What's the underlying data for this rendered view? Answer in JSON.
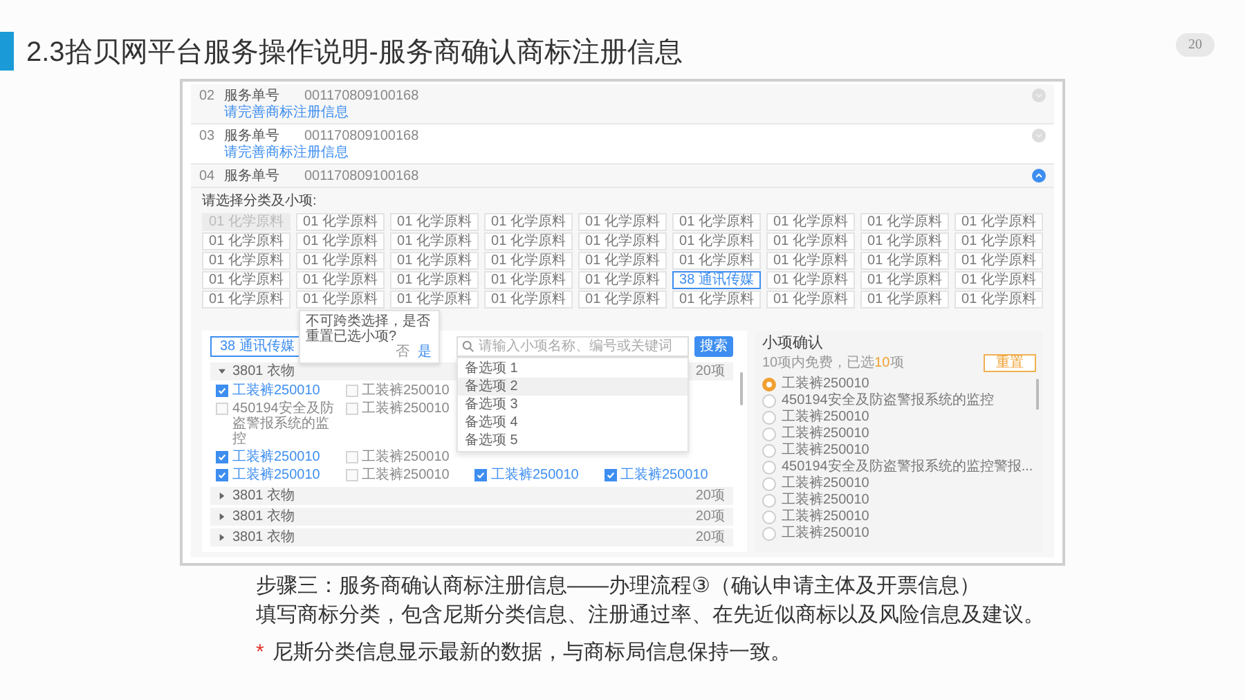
{
  "header": {
    "title": "2.3拾贝网平台服务操作说明-服务商确认商标注册信息",
    "page_number": "20"
  },
  "app": {
    "services": [
      {
        "index": "02",
        "label": "服务单号",
        "number": "001170809100168",
        "link": "请完善商标注册信息",
        "expanded": false
      },
      {
        "index": "03",
        "label": "服务单号",
        "number": "001170809100168",
        "link": "请完善商标注册信息",
        "expanded": false
      },
      {
        "index": "04",
        "label": "服务单号",
        "number": "001170809100168",
        "expanded": true
      }
    ],
    "class_prompt": "请选择分类及小项:",
    "class_rows": [
      [
        {
          "label": "01 化学原料",
          "disabled": true,
          "selected": false
        },
        {
          "label": "01 化学原料",
          "disabled": false,
          "selected": false
        },
        {
          "label": "01 化学原料",
          "disabled": false,
          "selected": false
        },
        {
          "label": "01 化学原料",
          "disabled": false,
          "selected": false
        },
        {
          "label": "01 化学原料",
          "disabled": false,
          "selected": false
        },
        {
          "label": "01 化学原料",
          "disabled": false,
          "selected": false
        },
        {
          "label": "01 化学原料",
          "disabled": false,
          "selected": false
        },
        {
          "label": "01 化学原料",
          "disabled": false,
          "selected": false
        },
        {
          "label": "01 化学原料",
          "disabled": false,
          "selected": false
        }
      ],
      [
        {
          "label": "01 化学原料",
          "disabled": false,
          "selected": false
        },
        {
          "label": "01 化学原料",
          "disabled": false,
          "selected": false
        },
        {
          "label": "01 化学原料",
          "disabled": false,
          "selected": false
        },
        {
          "label": "01 化学原料",
          "disabled": false,
          "selected": false
        },
        {
          "label": "01 化学原料",
          "disabled": false,
          "selected": false
        },
        {
          "label": "01 化学原料",
          "disabled": false,
          "selected": false
        },
        {
          "label": "01 化学原料",
          "disabled": false,
          "selected": false
        },
        {
          "label": "01 化学原料",
          "disabled": false,
          "selected": false
        },
        {
          "label": "01 化学原料",
          "disabled": false,
          "selected": false
        }
      ],
      [
        {
          "label": "01 化学原料",
          "disabled": false,
          "selected": false
        },
        {
          "label": "01 化学原料",
          "disabled": false,
          "selected": false
        },
        {
          "label": "01 化学原料",
          "disabled": false,
          "selected": false
        },
        {
          "label": "01 化学原料",
          "disabled": false,
          "selected": false
        },
        {
          "label": "01 化学原料",
          "disabled": false,
          "selected": false
        },
        {
          "label": "01 化学原料",
          "disabled": false,
          "selected": false
        },
        {
          "label": "01 化学原料",
          "disabled": false,
          "selected": false
        },
        {
          "label": "01 化学原料",
          "disabled": false,
          "selected": false
        },
        {
          "label": "01 化学原料",
          "disabled": false,
          "selected": false
        }
      ],
      [
        {
          "label": "01 化学原料",
          "disabled": false,
          "selected": false
        },
        {
          "label": "01 化学原料",
          "disabled": false,
          "selected": false
        },
        {
          "label": "01 化学原料",
          "disabled": false,
          "selected": false
        },
        {
          "label": "01 化学原料",
          "disabled": false,
          "selected": false
        },
        {
          "label": "01 化学原料",
          "disabled": false,
          "selected": false
        },
        {
          "label": "38 通讯传媒",
          "disabled": false,
          "selected": true
        },
        {
          "label": "01 化学原料",
          "disabled": false,
          "selected": false
        },
        {
          "label": "01 化学原料",
          "disabled": false,
          "selected": false
        },
        {
          "label": "01 化学原料",
          "disabled": false,
          "selected": false
        }
      ],
      [
        {
          "label": "01 化学原料",
          "disabled": false,
          "selected": false
        },
        {
          "label": "01 化学原料",
          "disabled": false,
          "selected": false
        },
        {
          "label": "01 化学原料",
          "disabled": false,
          "selected": false
        },
        {
          "label": "01 化学原料",
          "disabled": false,
          "selected": false
        },
        {
          "label": "01 化学原料",
          "disabled": false,
          "selected": false
        },
        {
          "label": "01 化学原料",
          "disabled": false,
          "selected": false
        },
        {
          "label": "01 化学原料",
          "disabled": false,
          "selected": false
        },
        {
          "label": "01 化学原料",
          "disabled": false,
          "selected": false
        },
        {
          "label": "01 化学原料",
          "disabled": false,
          "selected": false
        }
      ]
    ],
    "popover": {
      "message": "不可跨类选择，是否重置已选小项?",
      "buttons": [
        "否",
        "是"
      ]
    },
    "selected_class_button": "38 通讯传媒",
    "search": {
      "placeholder": "请输入小项名称、编号或关键词",
      "button": "搜索",
      "options": [
        {
          "label": "备选项 1",
          "selected": false
        },
        {
          "label": "备选项 2",
          "selected": true
        },
        {
          "label": "备选项 3",
          "selected": false
        },
        {
          "label": "备选项 4",
          "selected": false
        },
        {
          "label": "备选项 5",
          "selected": false
        }
      ]
    },
    "groups": [
      {
        "name": "3801 衣物",
        "count": "20项",
        "expanded": true,
        "rows": [
          [
            {
              "label": "工装裤250010",
              "checked": true
            },
            {
              "label": "工装裤250010",
              "checked": false
            }
          ],
          [
            {
              "label": "450194安全及防盗警报系统的监控",
              "checked": false
            },
            {
              "label": "工装裤250010",
              "checked": false
            }
          ],
          [
            {
              "label": "工装裤250010",
              "checked": true
            },
            {
              "label": "工装裤250010",
              "checked": false
            }
          ],
          [
            {
              "label": "工装裤250010",
              "checked": true
            },
            {
              "label": "工装裤250010",
              "checked": false
            },
            {
              "label": "工装裤250010",
              "checked": true
            },
            {
              "label": "工装裤250010",
              "checked": true
            }
          ]
        ]
      },
      {
        "name": "3801 衣物",
        "count": "20项",
        "expanded": false
      },
      {
        "name": "3801 衣物",
        "count": "20项",
        "expanded": false
      },
      {
        "name": "3801 衣物",
        "count": "20项",
        "expanded": false
      }
    ],
    "confirm": {
      "title": "小项确认",
      "note": "10项内免费，已选",
      "count": "10",
      "unit": "项",
      "reset": "重置",
      "items": [
        {
          "label": "工装裤250010",
          "selected": true
        },
        {
          "label": "450194安全及防盗警报系统的监控",
          "selected": false
        },
        {
          "label": "工装裤250010",
          "selected": false
        },
        {
          "label": "工装裤250010",
          "selected": false
        },
        {
          "label": "工装裤250010",
          "selected": false
        },
        {
          "label": "450194安全及防盗警报系统的监控警报...",
          "selected": false
        },
        {
          "label": "工装裤250010",
          "selected": false
        },
        {
          "label": "工装裤250010",
          "selected": false
        },
        {
          "label": "工装裤250010",
          "selected": false
        },
        {
          "label": "工装裤250010",
          "selected": false
        }
      ]
    }
  },
  "caption": {
    "step": "步骤三：服务商确认商标注册信息——办理流程③（确认申请主体及开票信息）",
    "description": "填写商标分类，包含尼斯分类信息、注册通过率、在先近似商标以及风险信息及建议。",
    "note_mark": "*",
    "note": "尼斯分类信息显示最新的数据，与商标局信息保持一致。"
  }
}
